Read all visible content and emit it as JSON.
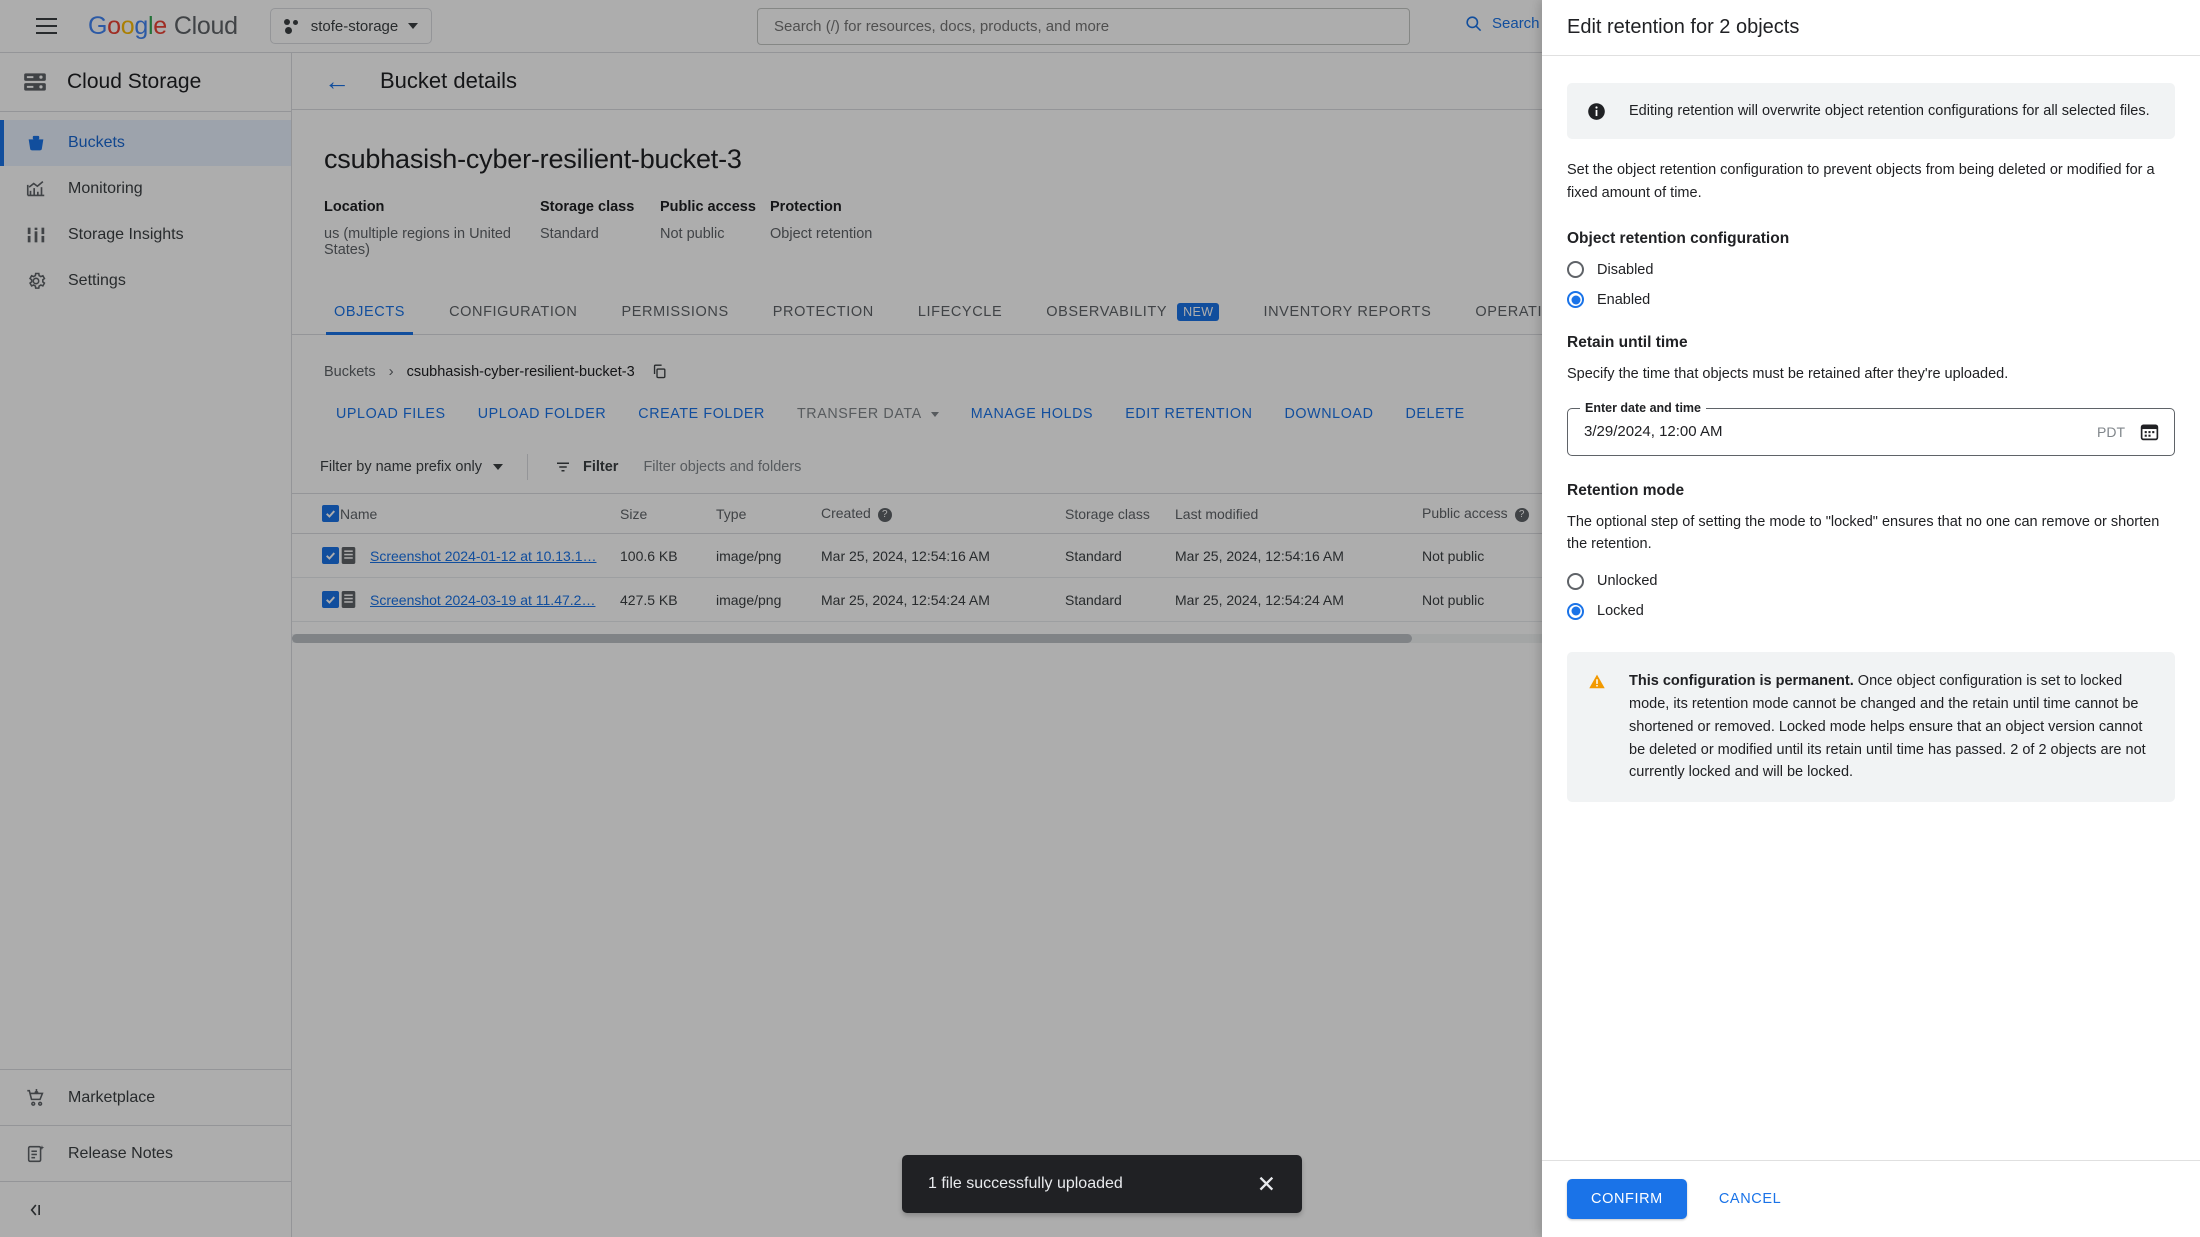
{
  "topbar": {
    "brand": "Google Cloud",
    "brand_letters": [
      "G",
      "o",
      "o",
      "g",
      "l",
      "e"
    ],
    "brand_suffix": "Cloud",
    "project": "stofe-storage",
    "search_placeholder": "Search (/) for resources, docs, products, and more",
    "search_value": "",
    "search_button": "Search"
  },
  "sidebar": {
    "product": "Cloud Storage",
    "items": [
      {
        "label": "Buckets",
        "icon": "bucket-icon",
        "active": true
      },
      {
        "label": "Monitoring",
        "icon": "monitoring-icon",
        "active": false
      },
      {
        "label": "Storage Insights",
        "icon": "insights-icon",
        "active": false
      },
      {
        "label": "Settings",
        "icon": "gear-icon",
        "active": false
      }
    ],
    "bottom_items": [
      {
        "label": "Marketplace",
        "icon": "cart-icon"
      },
      {
        "label": "Release Notes",
        "icon": "notes-icon"
      }
    ],
    "collapse_label": "collapse-sidebar-icon"
  },
  "page": {
    "header_title": "Bucket details",
    "bucket_name": "csubhasish-cyber-resilient-bucket-3",
    "meta": [
      {
        "key": "Location",
        "value": "us (multiple regions in United States)"
      },
      {
        "key": "Storage class",
        "value": "Standard"
      },
      {
        "key": "Public access",
        "value": "Not public"
      },
      {
        "key": "Protection",
        "value": "Object retention"
      }
    ],
    "tabs": [
      {
        "label": "OBJECTS",
        "active": true,
        "badge": ""
      },
      {
        "label": "CONFIGURATION",
        "active": false,
        "badge": ""
      },
      {
        "label": "PERMISSIONS",
        "active": false,
        "badge": ""
      },
      {
        "label": "PROTECTION",
        "active": false,
        "badge": ""
      },
      {
        "label": "LIFECYCLE",
        "active": false,
        "badge": ""
      },
      {
        "label": "OBSERVABILITY",
        "active": false,
        "badge": "NEW"
      },
      {
        "label": "INVENTORY REPORTS",
        "active": false,
        "badge": ""
      },
      {
        "label": "OPERATIONS",
        "active": false,
        "badge": ""
      }
    ],
    "breadcrumb": {
      "root": "Buckets",
      "separator": "›",
      "current": "csubhasish-cyber-resilient-bucket-3",
      "copy_icon": "copy-icon"
    },
    "actions": [
      {
        "label": "UPLOAD FILES",
        "disabled": false,
        "caret": false
      },
      {
        "label": "UPLOAD FOLDER",
        "disabled": false,
        "caret": false
      },
      {
        "label": "CREATE FOLDER",
        "disabled": false,
        "caret": false
      },
      {
        "label": "TRANSFER DATA",
        "disabled": true,
        "caret": true
      },
      {
        "label": "MANAGE HOLDS",
        "disabled": false,
        "caret": false
      },
      {
        "label": "EDIT RETENTION",
        "disabled": false,
        "caret": false
      },
      {
        "label": "DOWNLOAD",
        "disabled": false,
        "caret": false
      },
      {
        "label": "DELETE",
        "disabled": false,
        "caret": false
      }
    ],
    "filter": {
      "prefix_label": "Filter by name prefix only",
      "filter_label": "Filter",
      "filter_placeholder": "Filter objects and folders",
      "filter_value": ""
    },
    "table": {
      "columns": [
        "Name",
        "Size",
        "Type",
        "Created",
        "Storage class",
        "Last modified",
        "Public access"
      ],
      "help_columns": [
        "Created",
        "Public access"
      ],
      "rows": [
        {
          "selected": true,
          "name": "Screenshot 2024-01-12 at 10.13.1…",
          "size": "100.6 KB",
          "type": "image/png",
          "created": "Mar 25, 2024, 12:54:16 AM",
          "storage_class": "Standard",
          "last_modified": "Mar 25, 2024, 12:54:16 AM",
          "public_access": "Not public"
        },
        {
          "selected": true,
          "name": "Screenshot 2024-03-19 at 11.47.2…",
          "size": "427.5 KB",
          "type": "image/png",
          "created": "Mar 25, 2024, 12:54:24 AM",
          "storage_class": "Standard",
          "last_modified": "Mar 25, 2024, 12:54:24 AM",
          "public_access": "Not public"
        }
      ]
    }
  },
  "toast": {
    "message": "1 file successfully uploaded",
    "close_icon": "close-icon"
  },
  "panel": {
    "title": "Edit retention for 2 objects",
    "info_text": "Editing retention will overwrite object retention configurations for all selected files.",
    "intro": "Set the object retention configuration to prevent objects from being deleted or modified for a fixed amount of time.",
    "config_heading": "Object retention configuration",
    "config_options": [
      {
        "label": "Disabled",
        "selected": false
      },
      {
        "label": "Enabled",
        "selected": true
      }
    ],
    "retain_heading": "Retain until time",
    "retain_desc": "Specify the time that objects must be retained after they're uploaded.",
    "date_field": {
      "label": "Enter date and time",
      "value": "3/29/2024, 12:00 AM",
      "timezone": "PDT",
      "icon": "calendar-icon"
    },
    "mode_heading": "Retention mode",
    "mode_desc": "The optional step of setting the mode to \"locked\" ensures that no one can remove or shorten the retention.",
    "mode_options": [
      {
        "label": "Unlocked",
        "selected": false
      },
      {
        "label": "Locked",
        "selected": true
      }
    ],
    "warning_bold": "This configuration is permanent.",
    "warning_text": " Once object configuration is set to locked mode, its retention mode cannot be changed and the retain until time cannot be shortened or removed. Locked mode helps ensure that an object version cannot be deleted or modified until its retain until time has passed. 2 of 2 objects are not currently locked and will be locked.",
    "confirm_label": "CONFIRM",
    "cancel_label": "CANCEL"
  },
  "colors": {
    "accent": "#1a73e8",
    "warning": "#f29900",
    "toast_bg": "#202124",
    "box_bg": "#f1f3f4"
  }
}
